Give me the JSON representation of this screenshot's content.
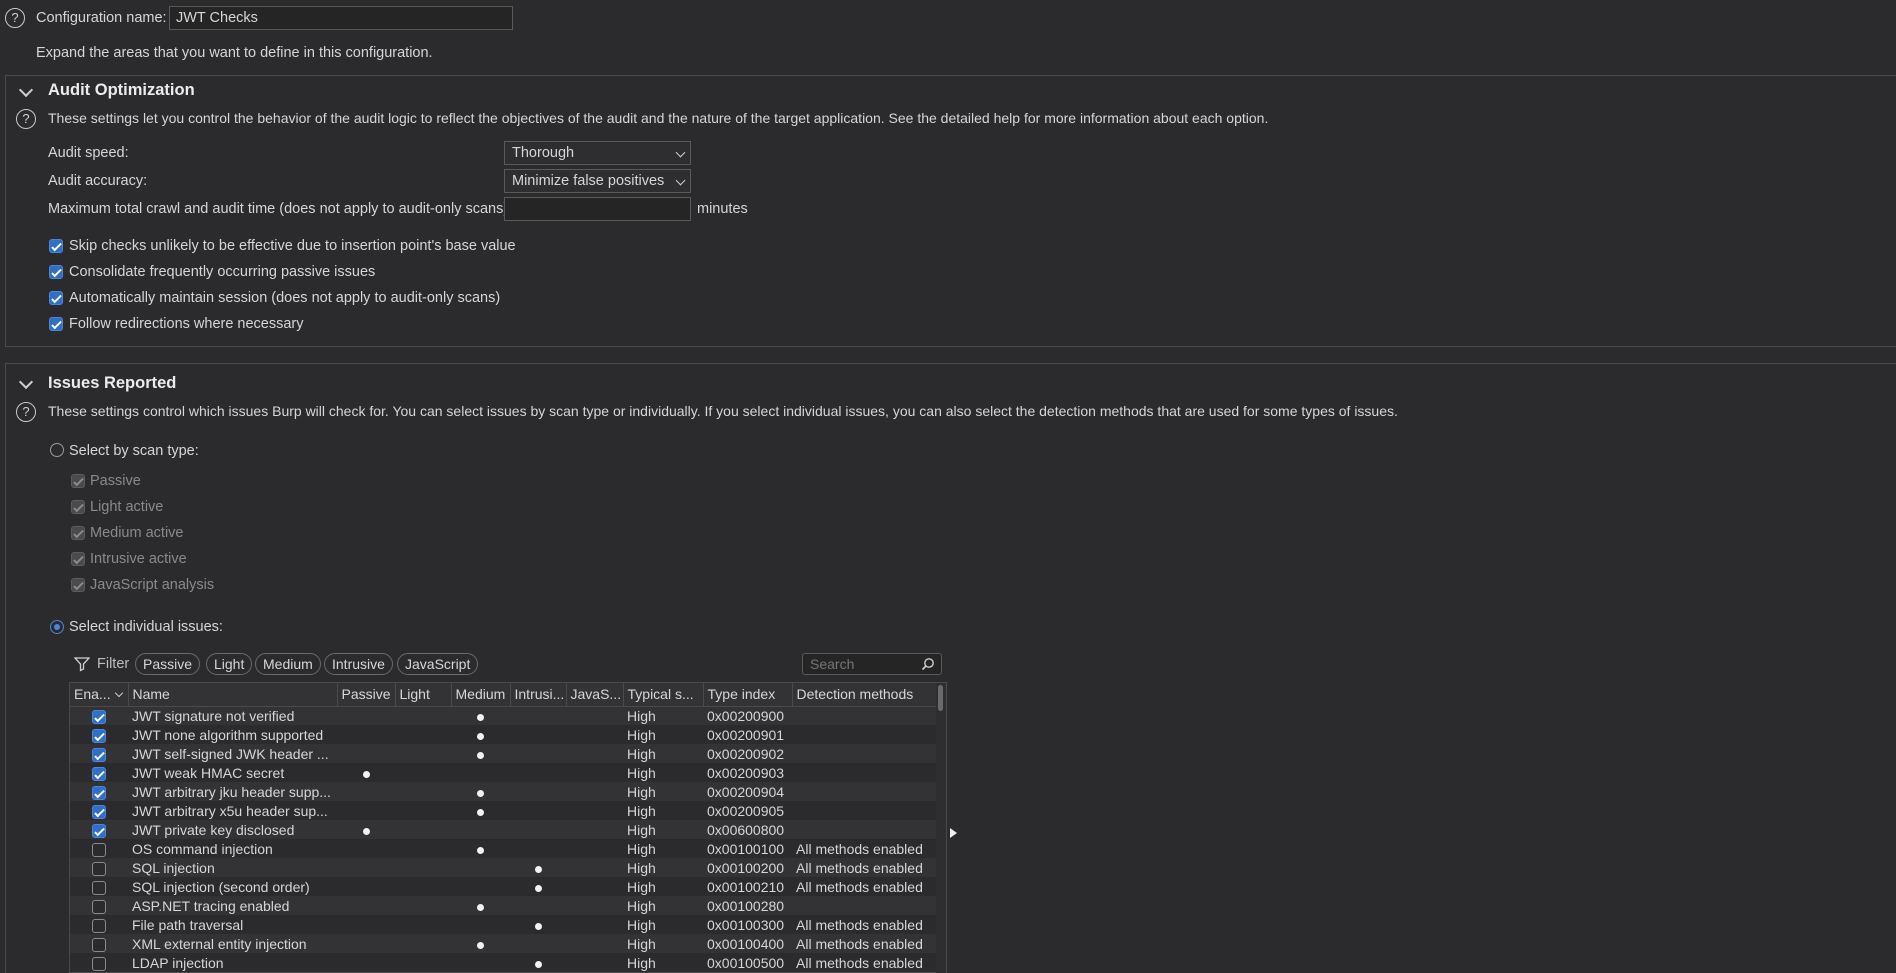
{
  "config": {
    "label": "Configuration name:",
    "value": "JWT Checks"
  },
  "expand_hint": "Expand the areas that you want to define in this configuration.",
  "audit": {
    "title": "Audit Optimization",
    "description": "These settings let you control the behavior of the audit logic to reflect the objectives of the audit and the nature of the target application. See the detailed help for more information about each option.",
    "speed_label": "Audit speed:",
    "speed_value": "Thorough",
    "accuracy_label": "Audit accuracy:",
    "accuracy_value": "Minimize false positives",
    "max_time_label": "Maximum total crawl and audit time (does not apply to audit-only scans):",
    "max_time_value": "",
    "max_time_unit": "minutes",
    "options": [
      {
        "label": "Skip checks unlikely to be effective due to insertion point's base value",
        "checked": true
      },
      {
        "label": "Consolidate frequently occurring passive issues",
        "checked": true
      },
      {
        "label": "Automatically maintain session (does not apply to audit-only scans)",
        "checked": true
      },
      {
        "label": "Follow redirections where necessary",
        "checked": true
      }
    ]
  },
  "issues": {
    "title": "Issues Reported",
    "description": "These settings control which issues Burp will check for. You can select issues by scan type or individually. If you select individual issues, you can also select the detection methods that are used for some types of issues.",
    "by_type_label": "Select by scan type:",
    "scan_types": [
      "Passive",
      "Light active",
      "Medium active",
      "Intrusive active",
      "JavaScript analysis"
    ],
    "individual_label": "Select individual issues:",
    "filter_label": "Filter",
    "filter_pills": [
      "Passive",
      "Light",
      "Medium",
      "Intrusive",
      "JavaScript"
    ],
    "search_placeholder": "Search",
    "columns": [
      "Ena...",
      "Name",
      "Passive",
      "Light",
      "Medium",
      "Intrusi...",
      "JavaS...",
      "Typical s...",
      "Type index",
      "Detection methods"
    ],
    "rows": [
      {
        "enabled": true,
        "name": "JWT signature not verified",
        "level": "Medium",
        "severity": "High",
        "index": "0x00200900",
        "detection": ""
      },
      {
        "enabled": true,
        "name": "JWT none algorithm supported",
        "level": "Medium",
        "severity": "High",
        "index": "0x00200901",
        "detection": ""
      },
      {
        "enabled": true,
        "name": "JWT self-signed JWK header ...",
        "level": "Medium",
        "severity": "High",
        "index": "0x00200902",
        "detection": ""
      },
      {
        "enabled": true,
        "name": "JWT weak HMAC secret",
        "level": "Passive",
        "severity": "High",
        "index": "0x00200903",
        "detection": ""
      },
      {
        "enabled": true,
        "name": "JWT arbitrary jku header supp...",
        "level": "Medium",
        "severity": "High",
        "index": "0x00200904",
        "detection": ""
      },
      {
        "enabled": true,
        "name": "JWT arbitrary x5u header sup...",
        "level": "Medium",
        "severity": "High",
        "index": "0x00200905",
        "detection": ""
      },
      {
        "enabled": true,
        "name": "JWT private key disclosed",
        "level": "Passive",
        "severity": "High",
        "index": "0x00600800",
        "detection": ""
      },
      {
        "enabled": false,
        "name": "OS command injection",
        "level": "Medium",
        "severity": "High",
        "index": "0x00100100",
        "detection": "All methods enabled"
      },
      {
        "enabled": false,
        "name": "SQL injection",
        "level": "Intrusive",
        "severity": "High",
        "index": "0x00100200",
        "detection": "All methods enabled"
      },
      {
        "enabled": false,
        "name": "SQL injection (second order)",
        "level": "Intrusive",
        "severity": "High",
        "index": "0x00100210",
        "detection": "All methods enabled"
      },
      {
        "enabled": false,
        "name": "ASP.NET tracing enabled",
        "level": "Medium",
        "severity": "High",
        "index": "0x00100280",
        "detection": ""
      },
      {
        "enabled": false,
        "name": "File path traversal",
        "level": "Intrusive",
        "severity": "High",
        "index": "0x00100300",
        "detection": "All methods enabled"
      },
      {
        "enabled": false,
        "name": "XML external entity injection",
        "level": "Medium",
        "severity": "High",
        "index": "0x00100400",
        "detection": "All methods enabled"
      },
      {
        "enabled": false,
        "name": "LDAP injection",
        "level": "Intrusive",
        "severity": "High",
        "index": "0x00100500",
        "detection": "All methods enabled"
      }
    ]
  }
}
